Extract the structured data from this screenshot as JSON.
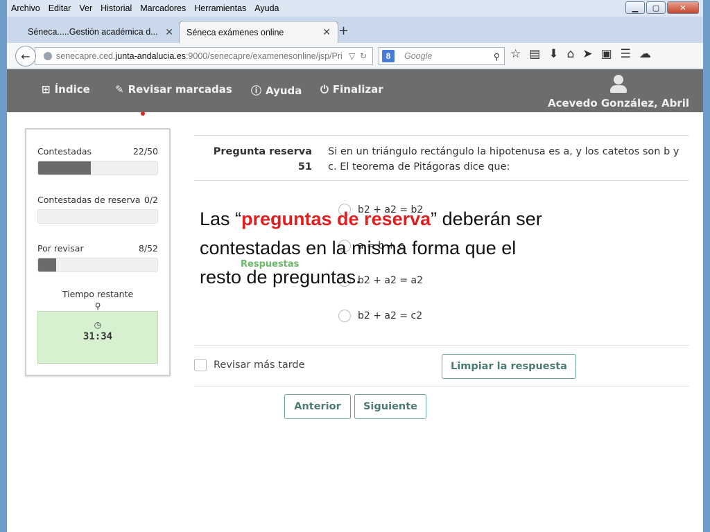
{
  "browser": {
    "menu": [
      "Archivo",
      "Editar",
      "Ver",
      "Historial",
      "Marcadores",
      "Herramientas",
      "Ayuda"
    ],
    "tabs": [
      {
        "title": "Séneca.....Gestión académica d..."
      },
      {
        "title": "Séneca exámenes online"
      }
    ],
    "url": {
      "prefix": "senecapre.ced.",
      "domain": "junta-andalucia.es",
      "suffix": ":9000/senecapre/examenesonline/jsp/Pri"
    },
    "search_placeholder": "Google"
  },
  "header": {
    "nav": [
      "Índice",
      "Revisar marcadas",
      "Ayuda",
      "Finalizar"
    ],
    "user": "Acevedo González, Abril"
  },
  "sidebar": {
    "stats": [
      {
        "label": "Contestadas",
        "count": "22/50",
        "progress": 0.44
      },
      {
        "label": "Contestadas de reserva",
        "count": "0/2",
        "progress": 0.0
      },
      {
        "label": "Por revisar",
        "count": "8/52",
        "progress": 0.154
      }
    ],
    "timer_title": "Tiempo restante",
    "timer_value": "31:34"
  },
  "question": {
    "label_line1": "Pregunta reserva",
    "number": "51",
    "text": "Si en un triángulo rectángulo la hipotenusa es a, y los catetos son b y c. El teorema de Pitágoras dice que:",
    "responses_label": "Respuestas",
    "options": [
      "b2 + a2 = b2",
      "a = b + c",
      "b2 + a2 = a2",
      "b2 + a2 = c2"
    ]
  },
  "controls": {
    "review_later": "Revisar más tarde",
    "clear": "Limpiar la respuesta",
    "prev": "Anterior",
    "next": "Siguiente"
  },
  "overlay": {
    "part1": "Las “",
    "highlight": "preguntas de reserva",
    "part2": "” deberán ser contestadas en la misma forma que el resto de preguntas."
  }
}
